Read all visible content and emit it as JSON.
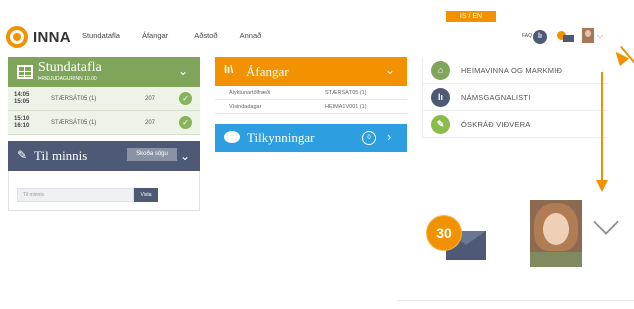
{
  "lang_switch": "IS / EN",
  "logo_text": "INNA",
  "nav": [
    "Stundatafla",
    "Áfangar",
    "Aðstoð",
    "Annað"
  ],
  "header_faq": "FAQ",
  "colors": {
    "orange": "#f39200",
    "green": "#7fa55a",
    "navy": "#4e5a75",
    "blue": "#2d9ee0"
  },
  "stundatafla": {
    "title": "Stundatafla",
    "subtitle": "ÞRIÐJUDAGURINN 10.00",
    "rows": [
      {
        "time": "14:05 15:05",
        "course": "STÆRSÁT05 (1)",
        "room": "207"
      },
      {
        "time": "15:10 16:10",
        "course": "STÆRSÁT05 (1)",
        "room": "207"
      }
    ]
  },
  "minnis": {
    "title": "Til minnis",
    "history_button": "Skoða sögu",
    "input_placeholder": "Til minnis",
    "save_button": "Vista"
  },
  "afangar": {
    "title": "Áfangar",
    "rows": [
      {
        "name": "Ályktunartölfræði",
        "code": "STÆRSÁT05 (1)"
      },
      {
        "name": "Vísindadagar",
        "code": "HEIMA1V001 (1)"
      }
    ]
  },
  "tilkynningar": {
    "title": "Tilkynningar",
    "count": "0"
  },
  "quick_links": [
    {
      "label": "HEIMAVINNA OG MARKMIÐ",
      "icon": "home-icon",
      "color": "#7fa55a"
    },
    {
      "label": "NÁMSGAGNALISTI",
      "icon": "books-icon",
      "color": "#4e5a75"
    },
    {
      "label": "ÓSKRÁÐ VIÐVERA",
      "icon": "pencil-icon",
      "color": "#8bbd4d"
    }
  ],
  "zoom": {
    "message_count": "30"
  }
}
